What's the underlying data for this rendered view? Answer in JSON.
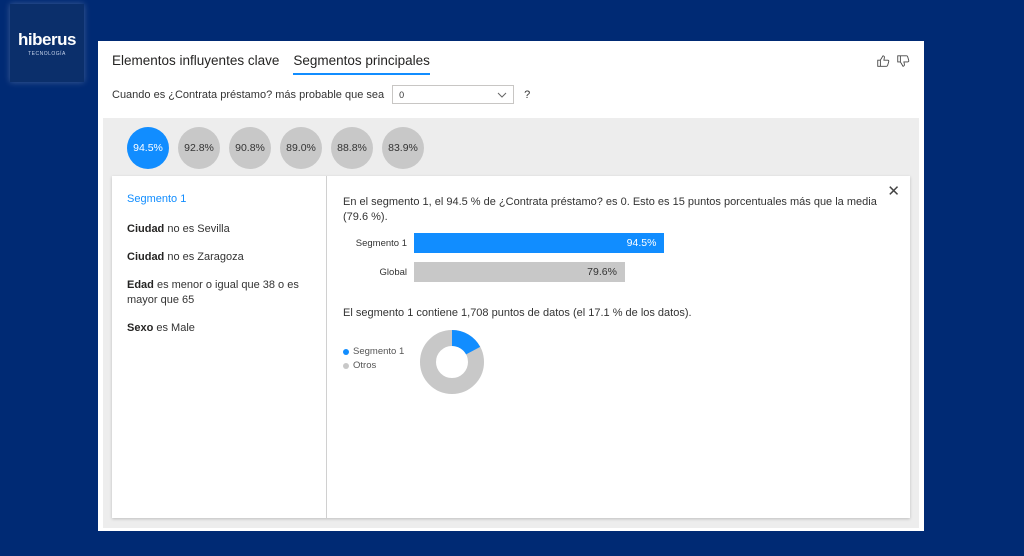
{
  "logo": {
    "brand": "hiberus",
    "sub": "TECNOLOGÍA"
  },
  "tabs": [
    {
      "label": "Elementos influyentes clave",
      "active": false
    },
    {
      "label": "Segmentos principales",
      "active": true
    }
  ],
  "question": {
    "label": "Cuando es ¿Contrata préstamo? más probable que sea",
    "value": "0",
    "help": "?"
  },
  "bubbles": [
    "94.5%",
    "92.8%",
    "90.8%",
    "89.0%",
    "88.8%",
    "83.9%"
  ],
  "segment": {
    "title": "Segmento 1",
    "conditions": [
      {
        "field": "Ciudad",
        "text": "no es Sevilla"
      },
      {
        "field": "Ciudad",
        "text": "no es Zaragoza"
      },
      {
        "field": "Edad",
        "text": "es menor o igual que 38 o es mayor que 65"
      },
      {
        "field": "Sexo",
        "text": "es Male"
      }
    ]
  },
  "detail": {
    "description": "En el segmento 1, el 94.5 % de ¿Contrata préstamo? es 0. Esto es 15 puntos porcentuales más que la media (79.6 %).",
    "bars": [
      {
        "label": "Segmento 1",
        "value": 94.5,
        "display": "94.5%"
      },
      {
        "label": "Global",
        "value": 79.6,
        "display": "79.6%"
      }
    ],
    "description2": "El segmento 1 contiene 1,708 puntos de datos (el 17.1 % de los datos).",
    "legend": [
      {
        "label": "Segmento 1",
        "color": "#118dff"
      },
      {
        "label": "Otros",
        "color": "#c8c8c8"
      }
    ],
    "donut_share": 0.171
  },
  "colors": {
    "accent": "#118dff",
    "gray": "#c8c8c8",
    "background": "#002a74"
  }
}
